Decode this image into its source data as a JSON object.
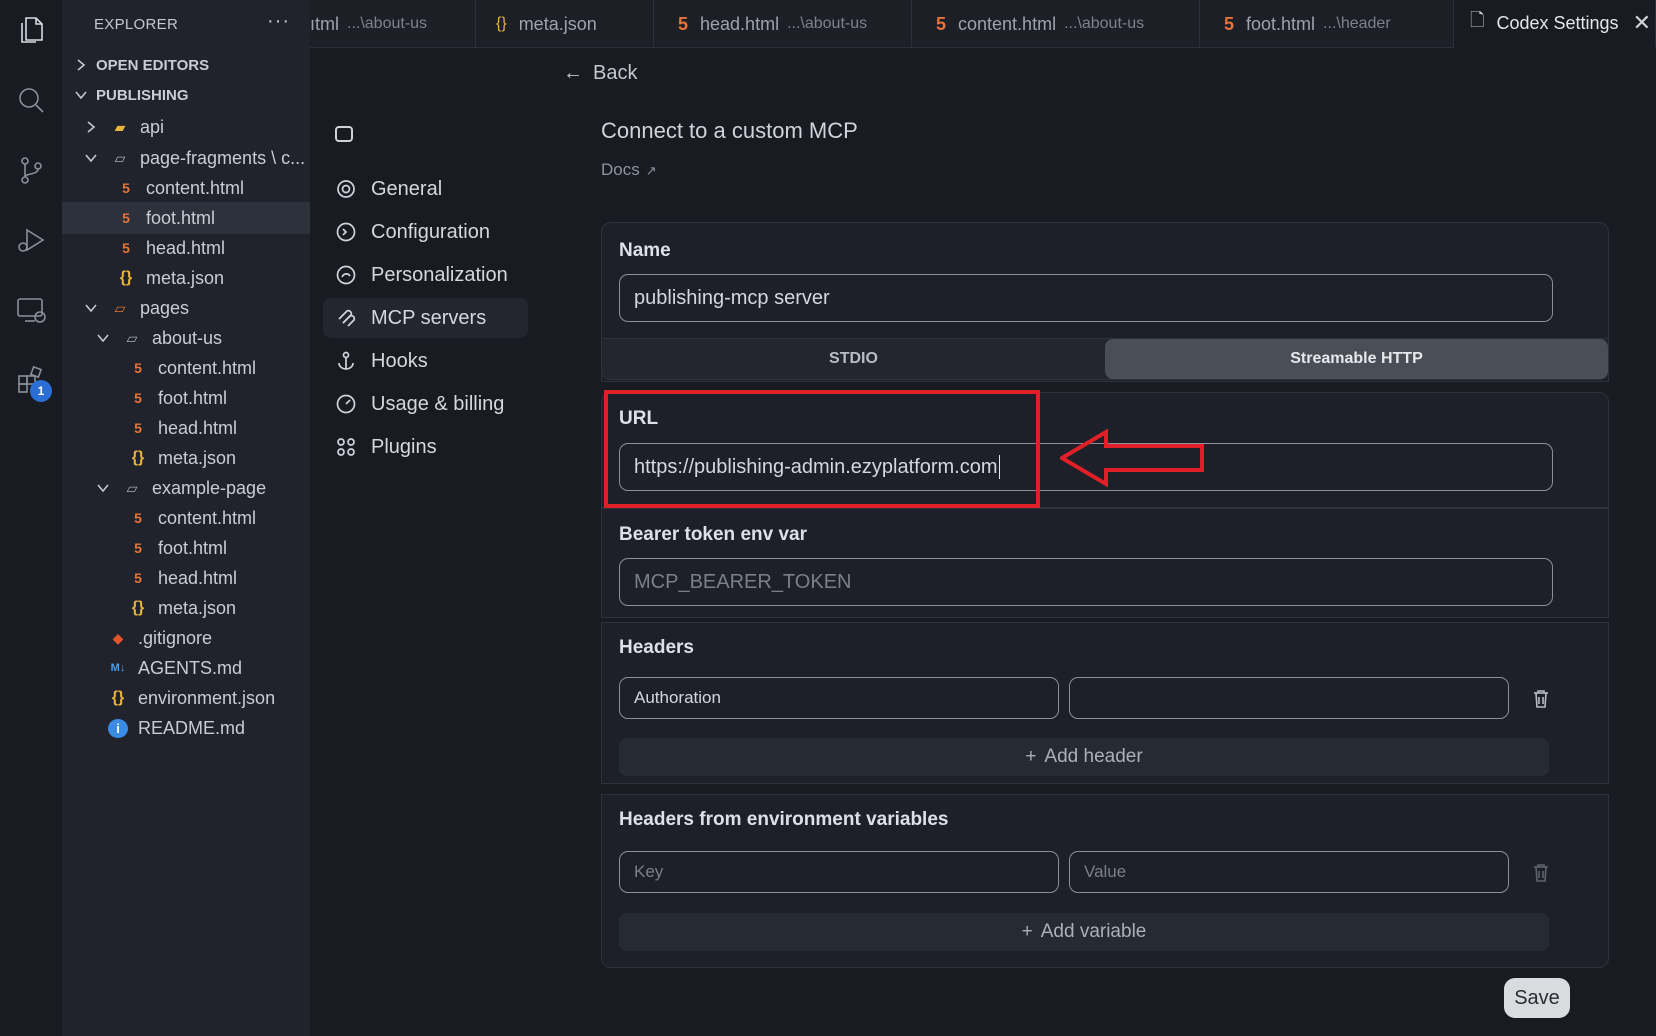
{
  "activity_bar": {
    "items": [
      "files-icon",
      "search-icon",
      "source-control-icon",
      "run-debug-icon",
      "remote-explorer-icon",
      "extensions-icon"
    ],
    "extensions_badge": "1"
  },
  "explorer": {
    "title": "EXPLORER",
    "more": "···",
    "open_editors_label": "OPEN EDITORS",
    "workspace_label": "PUBLISHING",
    "tree": [
      {
        "label": "api"
      },
      {
        "label": "page-fragments \\ c..."
      },
      {
        "label": "content.html"
      },
      {
        "label": "foot.html"
      },
      {
        "label": "head.html"
      },
      {
        "label": "meta.json"
      },
      {
        "label": "pages"
      },
      {
        "label": "about-us"
      },
      {
        "label": "content.html"
      },
      {
        "label": "foot.html"
      },
      {
        "label": "head.html"
      },
      {
        "label": "meta.json"
      },
      {
        "label": "example-page"
      },
      {
        "label": "content.html"
      },
      {
        "label": "foot.html"
      },
      {
        "label": "head.html"
      },
      {
        "label": "meta.json"
      },
      {
        "label": ".gitignore"
      },
      {
        "label": "AGENTS.md"
      },
      {
        "label": "environment.json"
      },
      {
        "label": "README.md"
      }
    ]
  },
  "tabs": [
    {
      "label": "ıtml",
      "path": "...\\about-us"
    },
    {
      "label": "meta.json",
      "path": ""
    },
    {
      "label": "head.html",
      "path": "...\\about-us"
    },
    {
      "label": "content.html",
      "path": "...\\about-us"
    },
    {
      "label": "foot.html",
      "path": "...\\header"
    },
    {
      "label": "Codex Settings",
      "path": ""
    }
  ],
  "settings_nav": {
    "items": [
      "General",
      "Configuration",
      "Personalization",
      "MCP servers",
      "Hooks",
      "Usage & billing",
      "Plugins"
    ]
  },
  "main": {
    "back_label": "Back",
    "title": "Connect to a custom MCP",
    "docs_label": "Docs",
    "name_label": "Name",
    "name_value": "publishing-mcp server",
    "transport": {
      "stdio": "STDIO",
      "http": "Streamable HTTP",
      "selected": "Streamable HTTP"
    },
    "url_label": "URL",
    "url_value": "https://publishing-admin.ezyplatform.com",
    "bearer_label": "Bearer token env var",
    "bearer_placeholder": "MCP_BEARER_TOKEN",
    "headers_label": "Headers",
    "header_key_value": "Authoration",
    "add_header_label": "Add header",
    "env_headers_label": "Headers from environment variables",
    "env_key_placeholder": "Key",
    "env_value_placeholder": "Value",
    "add_variable_label": "Add variable",
    "save_label": "Save"
  },
  "colors": {
    "annotation": "#e01f26",
    "html_icon": "#e8733a",
    "json_icon": "#e6b33c"
  }
}
